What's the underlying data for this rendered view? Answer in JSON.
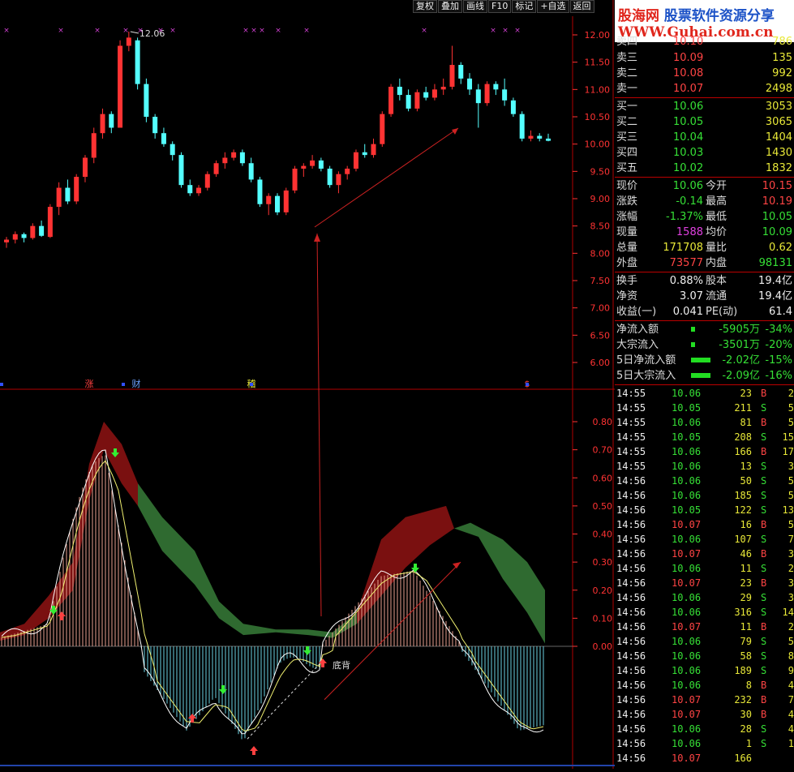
{
  "toolbar": {
    "items": [
      "复权",
      "叠加",
      "画线",
      "F10",
      "标记",
      "+自选",
      "返回"
    ]
  },
  "watermark": {
    "site": "股海网",
    "slogan": "股票软件资源分享",
    "url": "WWW.Guhai.com.cn"
  },
  "main_chart": {
    "y_ticks": [
      "12.00",
      "11.50",
      "11.00",
      "10.50",
      "10.00",
      "9.50",
      "9.00",
      "8.50",
      "8.00",
      "7.50",
      "7.00",
      "6.50",
      "6.00"
    ],
    "max_label": "12.06",
    "markers": [
      "涨",
      "财",
      "稽",
      "$"
    ]
  },
  "indicator": {
    "y_ticks": [
      "0.80",
      "0.70",
      "0.60",
      "0.50",
      "0.40",
      "0.30",
      "0.20",
      "0.10",
      "0.00"
    ],
    "annotation": "底背"
  },
  "quote": {
    "top_partial": {
      "label": "卖四",
      "price": "10.10",
      "vol": "786"
    },
    "sell": [
      {
        "label": "卖三",
        "price": "10.09",
        "vol": "135"
      },
      {
        "label": "卖二",
        "price": "10.08",
        "vol": "992"
      },
      {
        "label": "卖一",
        "price": "10.07",
        "vol": "2498"
      }
    ],
    "buy": [
      {
        "label": "买一",
        "price": "10.06",
        "vol": "3053"
      },
      {
        "label": "买二",
        "price": "10.05",
        "vol": "3065"
      },
      {
        "label": "买三",
        "price": "10.04",
        "vol": "1404"
      },
      {
        "label": "买四",
        "price": "10.03",
        "vol": "1430"
      },
      {
        "label": "买五",
        "price": "10.02",
        "vol": "1832"
      }
    ],
    "stats": [
      {
        "l1": "现价",
        "v1": "10.06",
        "c1": "g",
        "l2": "今开",
        "v2": "10.15",
        "c2": "r"
      },
      {
        "l1": "涨跌",
        "v1": "-0.14",
        "c1": "g",
        "l2": "最高",
        "v2": "10.19",
        "c2": "r"
      },
      {
        "l1": "涨幅",
        "v1": "-1.37%",
        "c1": "g",
        "l2": "最低",
        "v2": "10.05",
        "c2": "g"
      },
      {
        "l1": "现量",
        "v1": "1588",
        "c1": "m",
        "l2": "均价",
        "v2": "10.09",
        "c2": "g"
      },
      {
        "l1": "总量",
        "v1": "171708",
        "c1": "y",
        "l2": "量比",
        "v2": "0.62",
        "c2": "y"
      },
      {
        "l1": "外盘",
        "v1": "73577",
        "c1": "r",
        "l2": "内盘",
        "v2": "98131",
        "c2": "g"
      }
    ],
    "fund": [
      {
        "l1": "换手",
        "v1": "0.88%",
        "l2": "股本",
        "v2": "19.4亿"
      },
      {
        "l1": "净资",
        "v1": "3.07",
        "l2": "流通",
        "v2": "19.4亿"
      },
      {
        "l1": "收益(一)",
        "v1": "0.041",
        "l2": "PE(动)",
        "v2": "61.4"
      }
    ],
    "flows": [
      {
        "label": "净流入额",
        "val": "-5905万",
        "pct": "-34%",
        "bar": 0.06
      },
      {
        "label": "大宗流入",
        "val": "-3501万",
        "pct": "-20%",
        "bar": 0.04
      },
      {
        "label": "5日净流入额",
        "val": "-2.02亿",
        "pct": "-15%",
        "bar": 0.6
      },
      {
        "label": "5日大宗流入",
        "val": "-2.09亿",
        "pct": "-16%",
        "bar": 0.6
      }
    ]
  },
  "ticks": [
    {
      "t": "14:55",
      "p": "10.06",
      "v": "23",
      "s": "B",
      "n": "2"
    },
    {
      "t": "14:55",
      "p": "10.05",
      "v": "211",
      "s": "S",
      "n": "5"
    },
    {
      "t": "14:55",
      "p": "10.06",
      "v": "81",
      "s": "B",
      "n": "5"
    },
    {
      "t": "14:55",
      "p": "10.05",
      "v": "208",
      "s": "S",
      "n": "15"
    },
    {
      "t": "14:55",
      "p": "10.06",
      "v": "166",
      "s": "B",
      "n": "17"
    },
    {
      "t": "14:55",
      "p": "10.06",
      "v": "13",
      "s": "S",
      "n": "3"
    },
    {
      "t": "14:56",
      "p": "10.06",
      "v": "50",
      "s": "S",
      "n": "5"
    },
    {
      "t": "14:56",
      "p": "10.06",
      "v": "185",
      "s": "S",
      "n": "5"
    },
    {
      "t": "14:56",
      "p": "10.05",
      "v": "122",
      "s": "S",
      "n": "13"
    },
    {
      "t": "14:56",
      "p": "10.07",
      "v": "16",
      "s": "B",
      "n": "5"
    },
    {
      "t": "14:56",
      "p": "10.06",
      "v": "107",
      "s": "S",
      "n": "7"
    },
    {
      "t": "14:56",
      "p": "10.07",
      "v": "46",
      "s": "B",
      "n": "3"
    },
    {
      "t": "14:56",
      "p": "10.06",
      "v": "11",
      "s": "S",
      "n": "2"
    },
    {
      "t": "14:56",
      "p": "10.07",
      "v": "23",
      "s": "B",
      "n": "3"
    },
    {
      "t": "14:56",
      "p": "10.06",
      "v": "29",
      "s": "S",
      "n": "3"
    },
    {
      "t": "14:56",
      "p": "10.06",
      "v": "316",
      "s": "S",
      "n": "14"
    },
    {
      "t": "14:56",
      "p": "10.07",
      "v": "11",
      "s": "B",
      "n": "2"
    },
    {
      "t": "14:56",
      "p": "10.06",
      "v": "79",
      "s": "S",
      "n": "5"
    },
    {
      "t": "14:56",
      "p": "10.06",
      "v": "58",
      "s": "S",
      "n": "8"
    },
    {
      "t": "14:56",
      "p": "10.06",
      "v": "189",
      "s": "S",
      "n": "9"
    },
    {
      "t": "14:56",
      "p": "10.06",
      "v": "8",
      "s": "B",
      "n": "4"
    },
    {
      "t": "14:56",
      "p": "10.07",
      "v": "232",
      "s": "B",
      "n": "7"
    },
    {
      "t": "14:56",
      "p": "10.07",
      "v": "30",
      "s": "B",
      "n": "4"
    },
    {
      "t": "14:56",
      "p": "10.06",
      "v": "28",
      "s": "S",
      "n": "4"
    },
    {
      "t": "14:56",
      "p": "10.06",
      "v": "1",
      "s": "S",
      "n": "1"
    },
    {
      "t": "14:56",
      "p": "10.07",
      "v": "166",
      "s": "",
      "n": ""
    }
  ],
  "colors": {
    "up": "#ff3333",
    "down": "#54ffff",
    "border": "#b00000",
    "axis": "#ff3333",
    "red_band": "#7a1010",
    "green_band": "#2f6a30"
  },
  "candles": [
    [
      8.2,
      8.3,
      8.1,
      8.25
    ],
    [
      8.25,
      8.4,
      8.18,
      8.35
    ],
    [
      8.35,
      8.38,
      8.2,
      8.28
    ],
    [
      8.28,
      8.55,
      8.25,
      8.5
    ],
    [
      8.5,
      8.6,
      8.3,
      8.32
    ],
    [
      8.3,
      8.9,
      8.28,
      8.85
    ],
    [
      8.85,
      9.3,
      8.7,
      9.2
    ],
    [
      9.2,
      9.35,
      8.9,
      8.95
    ],
    [
      8.95,
      9.45,
      8.9,
      9.4
    ],
    [
      9.4,
      9.8,
      9.3,
      9.75
    ],
    [
      9.75,
      10.3,
      9.65,
      10.2
    ],
    [
      10.2,
      10.65,
      10.1,
      10.55
    ],
    [
      10.55,
      10.6,
      10.2,
      10.3
    ],
    [
      10.3,
      11.9,
      10.3,
      11.8
    ],
    [
      11.8,
      12.06,
      11.7,
      11.95
    ],
    [
      11.9,
      11.95,
      11.0,
      11.1
    ],
    [
      11.1,
      11.2,
      10.4,
      10.5
    ],
    [
      10.5,
      10.55,
      10.1,
      10.2
    ],
    [
      10.2,
      10.3,
      9.95,
      10.0
    ],
    [
      10.0,
      10.05,
      9.7,
      9.8
    ],
    [
      9.8,
      9.85,
      9.2,
      9.25
    ],
    [
      9.25,
      9.35,
      9.05,
      9.1
    ],
    [
      9.1,
      9.25,
      9.05,
      9.2
    ],
    [
      9.2,
      9.5,
      9.15,
      9.45
    ],
    [
      9.45,
      9.7,
      9.4,
      9.65
    ],
    [
      9.65,
      9.85,
      9.55,
      9.75
    ],
    [
      9.75,
      9.9,
      9.7,
      9.85
    ],
    [
      9.85,
      9.9,
      9.6,
      9.65
    ],
    [
      9.65,
      9.75,
      9.3,
      9.35
    ],
    [
      9.35,
      9.4,
      8.85,
      8.9
    ],
    [
      8.9,
      9.1,
      8.7,
      9.05
    ],
    [
      9.05,
      9.1,
      8.7,
      8.75
    ],
    [
      8.75,
      9.2,
      8.7,
      9.15
    ],
    [
      9.15,
      9.6,
      9.1,
      9.55
    ],
    [
      9.55,
      9.65,
      9.4,
      9.6
    ],
    [
      9.6,
      9.8,
      9.55,
      9.7
    ],
    [
      9.7,
      9.75,
      9.5,
      9.55
    ],
    [
      9.55,
      9.6,
      9.2,
      9.25
    ],
    [
      9.25,
      9.5,
      9.1,
      9.45
    ],
    [
      9.45,
      9.6,
      9.35,
      9.55
    ],
    [
      9.55,
      9.9,
      9.5,
      9.85
    ],
    [
      9.85,
      10.0,
      9.75,
      9.8
    ],
    [
      9.8,
      10.1,
      9.75,
      10.0
    ],
    [
      10.0,
      10.6,
      9.95,
      10.55
    ],
    [
      10.55,
      11.1,
      10.5,
      11.05
    ],
    [
      11.05,
      11.2,
      10.8,
      10.9
    ],
    [
      10.9,
      11.0,
      10.6,
      10.65
    ],
    [
      10.65,
      11.0,
      10.6,
      10.95
    ],
    [
      10.95,
      11.05,
      10.8,
      10.85
    ],
    [
      10.85,
      11.1,
      10.8,
      11.0
    ],
    [
      11.0,
      11.2,
      10.9,
      11.05
    ],
    [
      11.05,
      11.8,
      11.0,
      11.45
    ],
    [
      11.45,
      11.5,
      11.1,
      11.2
    ],
    [
      11.2,
      11.3,
      10.9,
      11.0
    ],
    [
      11.0,
      11.1,
      10.3,
      10.75
    ],
    [
      10.75,
      11.15,
      10.7,
      11.1
    ],
    [
      11.1,
      11.15,
      10.9,
      11.0
    ],
    [
      11.0,
      11.2,
      10.7,
      10.8
    ],
    [
      10.8,
      10.85,
      10.5,
      10.55
    ],
    [
      10.55,
      10.6,
      10.05,
      10.1
    ],
    [
      10.1,
      10.25,
      10.05,
      10.15
    ],
    [
      10.15,
      10.2,
      10.05,
      10.1
    ],
    [
      10.1,
      10.19,
      10.05,
      10.06
    ]
  ]
}
